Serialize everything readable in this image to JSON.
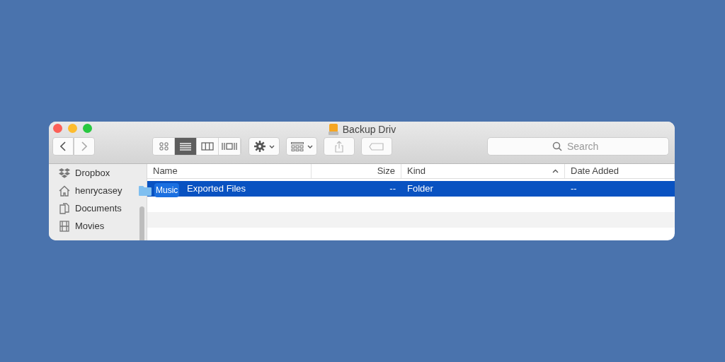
{
  "window": {
    "title": "Backup Driv"
  },
  "toolbar": {
    "views": [
      {
        "kind": "icons",
        "selected": false
      },
      {
        "kind": "list",
        "selected": true
      },
      {
        "kind": "columns",
        "selected": false
      },
      {
        "kind": "gallery",
        "selected": false
      }
    ],
    "search": {
      "placeholder": "Search"
    }
  },
  "sidebar": {
    "items": [
      {
        "label": "Dropbox",
        "kind": "dropbox"
      },
      {
        "label": "henrycasey",
        "kind": "home"
      },
      {
        "label": "Documents",
        "kind": "documents"
      },
      {
        "label": "Movies",
        "kind": "movies"
      }
    ]
  },
  "table": {
    "columns": [
      {
        "label": "Name",
        "sorted": false
      },
      {
        "label": "Size",
        "sorted": false
      },
      {
        "label": "Kind",
        "sorted": true
      },
      {
        "label": "Date Added",
        "sorted": false
      }
    ],
    "rows": [
      {
        "name": "Exported Files",
        "size": "--",
        "file_kind": "Folder",
        "date_added": "--",
        "selected": true
      }
    ]
  },
  "drag": {
    "label": "Music"
  }
}
